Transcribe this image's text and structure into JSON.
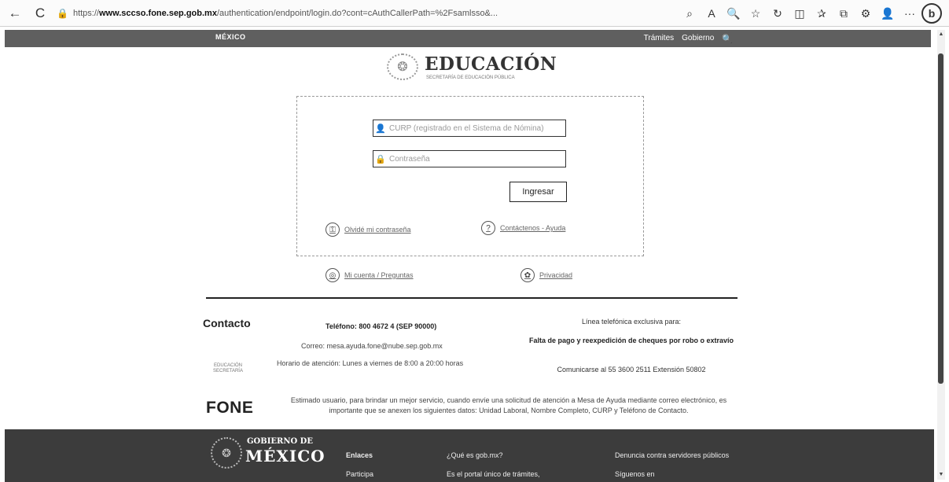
{
  "browser": {
    "url_prefix": "https://",
    "url_host": "www.sccso.fone.sep.gob.mx",
    "url_rest": "/authentication/endpoint/login.do?cont=cAuthCallerPath=%2Fsamlsso&...",
    "back": "←",
    "reload": "C",
    "more": "···",
    "bing": "b"
  },
  "gob_bar": {
    "logo": "MÉXICO",
    "links": [
      "Trámites",
      "Gobierno"
    ],
    "search_icon": "🔍"
  },
  "header": {
    "title": "EDUCACIÓN",
    "subtitle": "SECRETARÍA DE EDUCACIÓN PÚBLICA"
  },
  "login": {
    "curp_placeholder": "CURP (registrado en el Sistema de Nómina)",
    "password_placeholder": "Contraseña",
    "submit_label": "Ingresar",
    "link_left": "Olvidé mi contraseña",
    "link_right": "Contáctenos - Ayuda"
  },
  "outer_links": {
    "left": "Mi cuenta / Preguntas",
    "right": "Privacidad"
  },
  "contact": {
    "title": "Contacto",
    "phone": "Teléfono: 800 4672 4 (SEP 90000)",
    "email": "Correo: mesa.ayuda.fone@nube.sep.gob.mx",
    "hours": "Horario de atención: Lunes a viernes de 8:00 a 20:00 horas",
    "sep_logo": "EDUCACIÓN SECRETARÍA",
    "line_title": "Línea telefónica exclusiva para:",
    "line_subject": "Falta de pago y reexpedición de cheques por robo o extravío",
    "line_phone": "Comunicarse al 55 3600 2511 Extensión 50802"
  },
  "fone": {
    "title": "FONE",
    "text": "Estimado usuario, para brindar un mejor servicio, cuando envíe una solicitud de atención a Mesa de Ayuda mediante correo electrónico, es importante que se anexen los siguientes datos: Unidad Laboral, Nombre Completo, CURP y Teléfono de Contacto."
  },
  "footer": {
    "gob": "GOBIERNO DE",
    "mexico": "MÉXICO",
    "col1": [
      "Enlaces",
      "Participa"
    ],
    "col2": [
      "¿Qué es gob.mx?",
      "Es el portal único de trámites,"
    ],
    "col3": [
      "Denuncia contra servidores públicos",
      "Síguenos en"
    ]
  }
}
